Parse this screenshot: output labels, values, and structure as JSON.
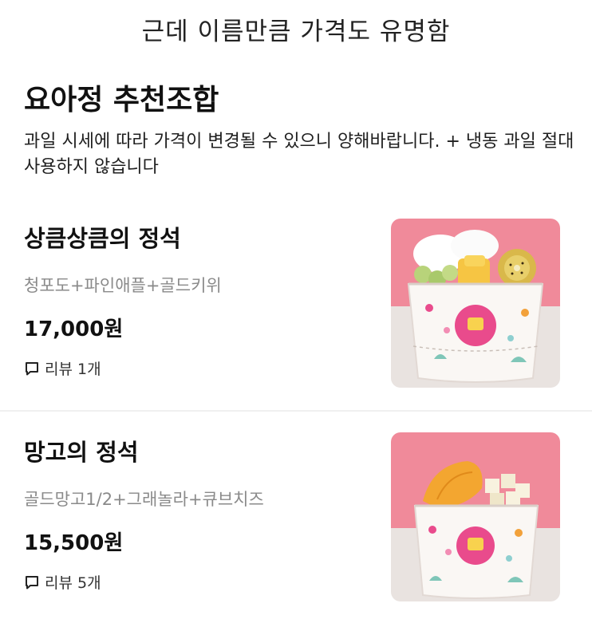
{
  "caption": "근데 이름만큼 가격도 유명함",
  "section": {
    "title": "요아정 추천조합",
    "notice": "과일 시세에 따라 가격이 변경될 수 있으니 양해바랍니다. + 냉동 과일 절대 사용하지 않습니다"
  },
  "menu": [
    {
      "name": "상큼상큼의 정석",
      "description": "청포도+파인애플+골드키위",
      "price": "17,000원",
      "review_label": "리뷰 1개",
      "photo_icon": "yogurt-cup-photo"
    },
    {
      "name": "망고의 정석",
      "description": "골드망고1/2+그래놀라+큐브치즈",
      "price": "15,500원",
      "review_label": "리뷰 5개",
      "photo_icon": "yogurt-cup-photo"
    }
  ],
  "colors": {
    "photo_background": "#f08a9a",
    "photo_floor": "#e9e3e0",
    "description_gray": "#8a8a8a"
  }
}
